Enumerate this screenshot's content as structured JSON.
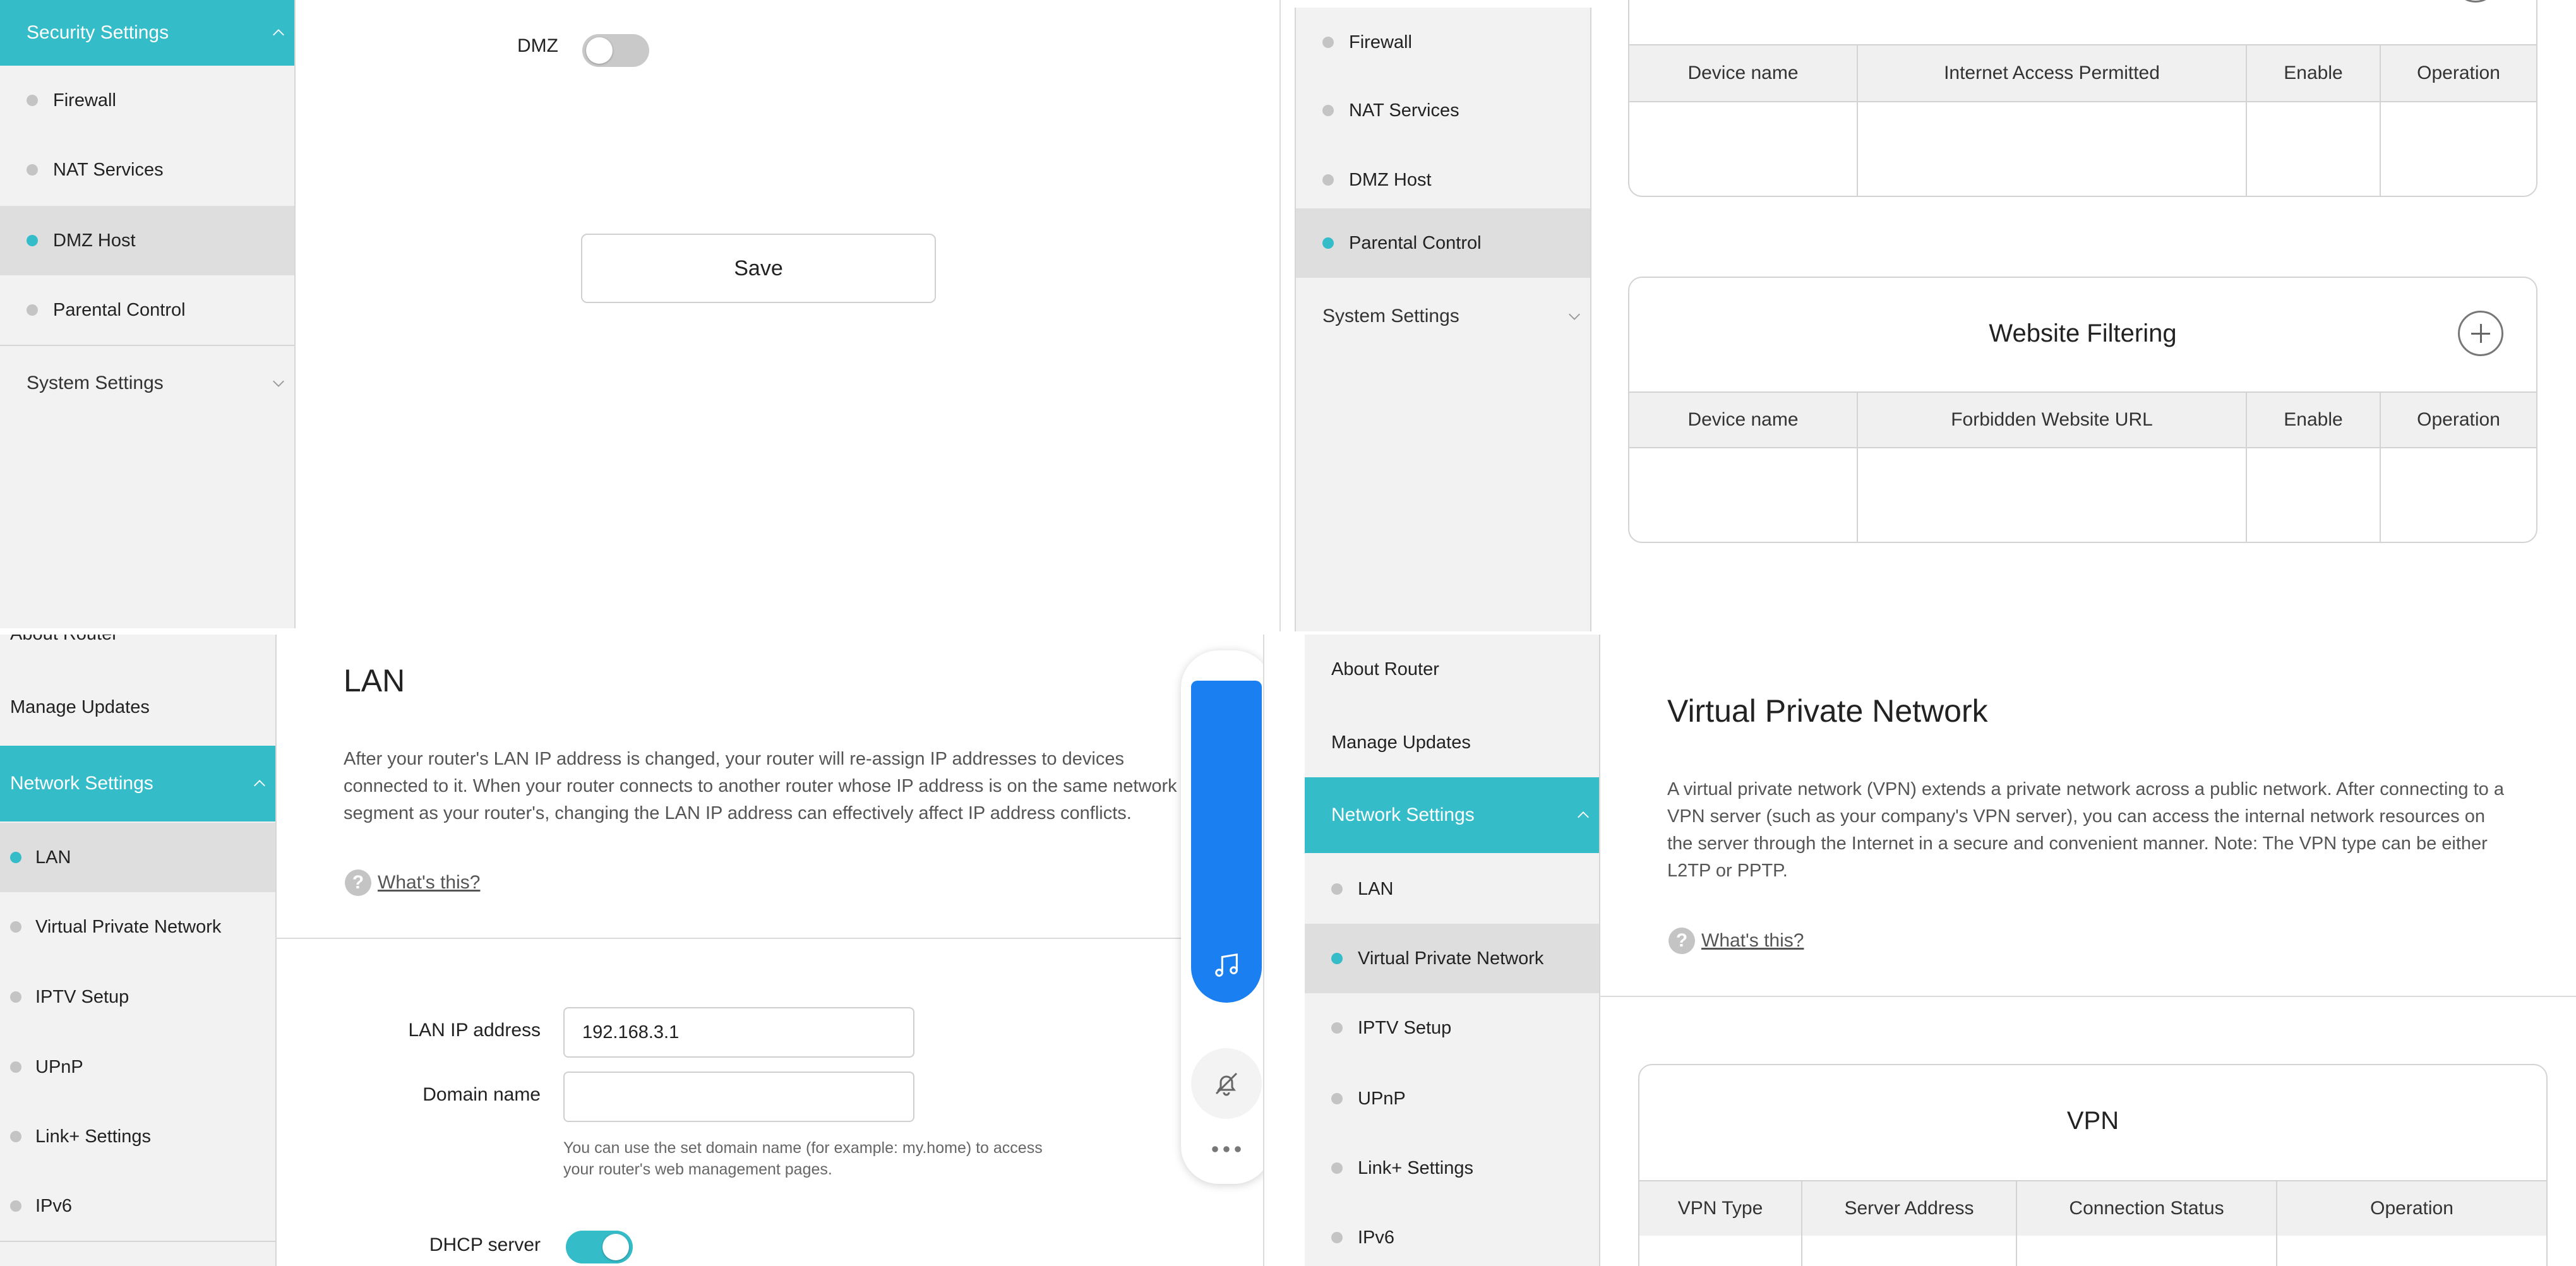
{
  "colors": {
    "accent": "#35bcc9",
    "floating_blue": "#1a7ff0"
  },
  "q1": {
    "sidebar": {
      "section_security": "Security Settings",
      "items": [
        "Firewall",
        "NAT Services",
        "DMZ Host",
        "Parental Control"
      ],
      "selected": "DMZ Host",
      "section_system": "System Settings"
    },
    "dmz_label": "DMZ",
    "dmz_enabled": false,
    "save_label": "Save"
  },
  "q2": {
    "sidebar": {
      "items": [
        "Firewall",
        "NAT Services",
        "DMZ Host",
        "Parental Control"
      ],
      "selected": "Parental Control",
      "section_system": "System Settings"
    },
    "access_table": {
      "headers": [
        "Device name",
        "Internet Access Permitted",
        "Enable",
        "Operation"
      ]
    },
    "website_filtering": {
      "title": "Website Filtering",
      "headers": [
        "Device name",
        "Forbidden Website URL",
        "Enable",
        "Operation"
      ]
    }
  },
  "q3": {
    "sidebar": {
      "partial_top": "About Router",
      "manage_updates": "Manage Updates",
      "section_network": "Network Settings",
      "items": [
        "LAN",
        "Virtual Private Network",
        "IPTV Setup",
        "UPnP",
        "Link+ Settings",
        "IPv6"
      ],
      "selected": "LAN"
    },
    "title": "LAN",
    "description": "After your router's LAN IP address is changed, your router will re-assign IP addresses to devices connected to it. When your router connects to another router whose IP address is on the same network segment as your router's, changing the LAN IP address can effectively affect IP address conflicts.",
    "help_icon": "?",
    "help_link": "What's this?",
    "lan_ip_label": "LAN IP address",
    "lan_ip_value": "192.168.3.1",
    "domain_label": "Domain name",
    "domain_value": "",
    "domain_hint": "You can use the set domain name (for example: my.home) to access your router's web management pages.",
    "dhcp_label": "DHCP server",
    "dhcp_enabled": true
  },
  "floating_toolbar": {
    "icons": [
      "music-note-icon",
      "bell-off-icon",
      "more-icon"
    ]
  },
  "q4": {
    "sidebar": {
      "about_router": "About Router",
      "manage_updates": "Manage Updates",
      "section_network": "Network Settings",
      "items": [
        "LAN",
        "Virtual Private Network",
        "IPTV Setup",
        "UPnP",
        "Link+ Settings",
        "IPv6"
      ],
      "selected": "Virtual Private Network"
    },
    "title": "Virtual Private Network",
    "description": "A virtual private network (VPN) extends a private network across a public network. After connecting to a VPN server (such as your company's VPN server), you can access the internal network resources on the server through the Internet in a secure and convenient manner. Note: The VPN type can be either L2TP or PPTP.",
    "help_icon": "?",
    "help_link": "What's this?",
    "vpn_card": {
      "title": "VPN",
      "headers": [
        "VPN Type",
        "Server Address",
        "Connection Status",
        "Operation"
      ]
    }
  }
}
